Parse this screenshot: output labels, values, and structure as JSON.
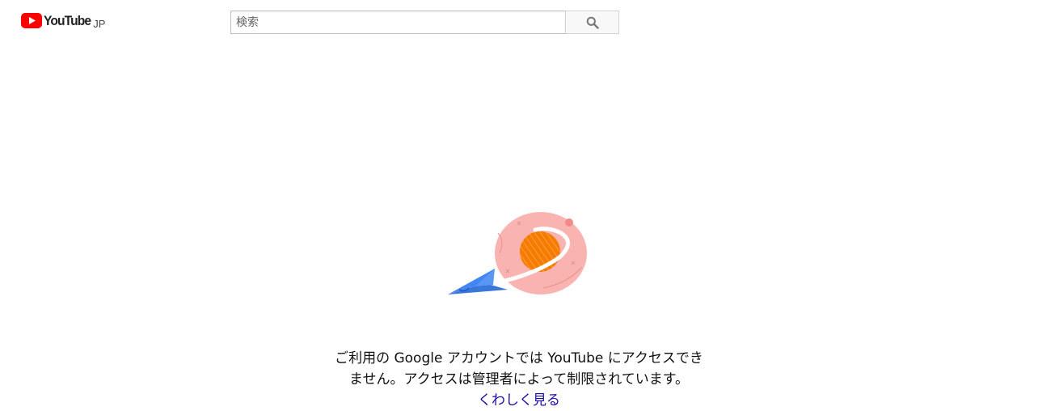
{
  "header": {
    "logo_text": "YouTube",
    "logo_country": "JP",
    "brand_color": "#ff0000"
  },
  "search": {
    "placeholder": "検索",
    "button_icon": "search-icon"
  },
  "illustration": {
    "icon": "paper-plane-planet-illustration",
    "colors": {
      "planet": "#f9b4b2",
      "core": "#f57c00",
      "plane": "#4285f4"
    }
  },
  "message": {
    "line1": "ご利用の Google アカウントでは YouTube にアクセスでき",
    "line2": "ません。アクセスは管理者によって制限されています。",
    "link_label": "くわしく見る"
  }
}
